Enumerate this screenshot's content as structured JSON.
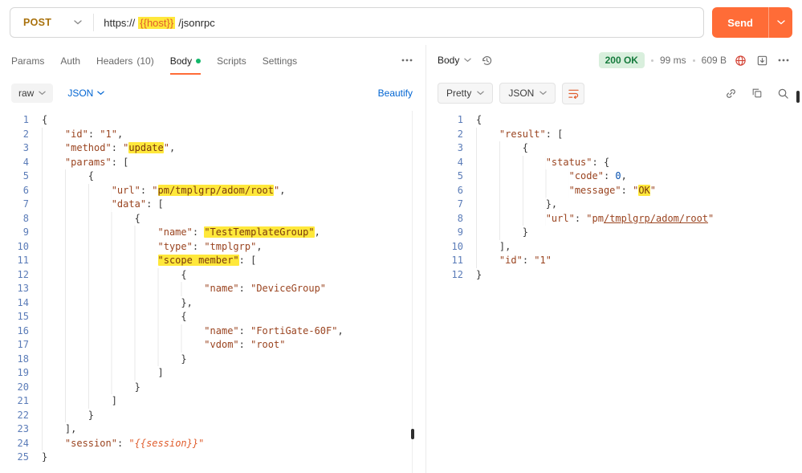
{
  "request_bar": {
    "method": "POST",
    "url_prefix": "https://",
    "url_variable": "{{host}}",
    "url_suffix": "/jsonrpc",
    "send_label": "Send"
  },
  "request_tabs": [
    {
      "label": "Params"
    },
    {
      "label": "Auth"
    },
    {
      "label": "Headers",
      "count": "(10)"
    },
    {
      "label": "Body",
      "active": true
    },
    {
      "label": "Scripts"
    },
    {
      "label": "Settings"
    }
  ],
  "request_toolbar": {
    "body_type": "raw",
    "language": "JSON",
    "beautify": "Beautify"
  },
  "response_header": {
    "body_label": "Body",
    "status": "200 OK",
    "time": "99 ms",
    "size": "609 B"
  },
  "response_toolbar": {
    "format": "Pretty",
    "language": "JSON"
  },
  "icons": {
    "method-chevron": "chevron-down",
    "send-options": "chevron-down",
    "more-options": "ellipsis-horizontal",
    "history": "clock-counterclockwise",
    "network-warning": "red-globe",
    "save-response": "download-box",
    "wrap-text": "text-wrap",
    "link": "chain-link",
    "copy": "copy-squares",
    "search": "magnifier"
  },
  "colors": {
    "accent": "#ff6c37",
    "link_blue": "#0265d2",
    "status_green": "#157a3c",
    "highlight_yellow": "#ffe83b",
    "method_post": "#a9710c"
  },
  "request_editor": {
    "lines": [
      [
        [
          "{",
          "p"
        ]
      ],
      [
        [
          "    ",
          "p"
        ],
        [
          "\"id\"",
          "s"
        ],
        [
          ": ",
          "p"
        ],
        [
          "\"1\"",
          "s"
        ],
        [
          ",",
          "p"
        ]
      ],
      [
        [
          "    ",
          "p"
        ],
        [
          "\"method\"",
          "s"
        ],
        [
          ": ",
          "p"
        ],
        [
          "\"",
          "s"
        ],
        [
          "update",
          "h"
        ],
        [
          "\"",
          "s"
        ],
        [
          ",",
          "p"
        ]
      ],
      [
        [
          "    ",
          "p"
        ],
        [
          "\"params\"",
          "s"
        ],
        [
          ": [",
          "p"
        ]
      ],
      [
        [
          "        {",
          "p"
        ]
      ],
      [
        [
          "            ",
          "p"
        ],
        [
          "\"url\"",
          "s"
        ],
        [
          ": ",
          "p"
        ],
        [
          "\"",
          "s"
        ],
        [
          "pm/tmplgrp/adom/root",
          "h"
        ],
        [
          "\"",
          "s"
        ],
        [
          ",",
          "p"
        ]
      ],
      [
        [
          "            ",
          "p"
        ],
        [
          "\"data\"",
          "s"
        ],
        [
          ": [",
          "p"
        ]
      ],
      [
        [
          "                {",
          "p"
        ]
      ],
      [
        [
          "                    ",
          "p"
        ],
        [
          "\"name\"",
          "s"
        ],
        [
          ": ",
          "p"
        ],
        [
          "\"TestTemplateGroup\"",
          "h"
        ],
        [
          ",",
          "p"
        ]
      ],
      [
        [
          "                    ",
          "p"
        ],
        [
          "\"type\"",
          "s"
        ],
        [
          ": ",
          "p"
        ],
        [
          "\"tmplgrp\"",
          "s"
        ],
        [
          ",",
          "p"
        ]
      ],
      [
        [
          "                    ",
          "p"
        ],
        [
          "\"scope member\"",
          "h"
        ],
        [
          ": [",
          "p"
        ]
      ],
      [
        [
          "                        {",
          "p"
        ]
      ],
      [
        [
          "                            ",
          "p"
        ],
        [
          "\"name\"",
          "s"
        ],
        [
          ": ",
          "p"
        ],
        [
          "\"DeviceGroup\"",
          "s"
        ]
      ],
      [
        [
          "                        },",
          "p"
        ]
      ],
      [
        [
          "                        {",
          "p"
        ]
      ],
      [
        [
          "                            ",
          "p"
        ],
        [
          "\"name\"",
          "s"
        ],
        [
          ": ",
          "p"
        ],
        [
          "\"FortiGate-60F\"",
          "s"
        ],
        [
          ",",
          "p"
        ]
      ],
      [
        [
          "                            ",
          "p"
        ],
        [
          "\"vdom\"",
          "s"
        ],
        [
          ": ",
          "p"
        ],
        [
          "\"root\"",
          "s"
        ]
      ],
      [
        [
          "                        }",
          "p"
        ]
      ],
      [
        [
          "                    ]",
          "p"
        ]
      ],
      [
        [
          "                }",
          "p"
        ]
      ],
      [
        [
          "            ]",
          "p"
        ]
      ],
      [
        [
          "        }",
          "p"
        ]
      ],
      [
        [
          "    ],",
          "p"
        ]
      ],
      [
        [
          "    ",
          "p"
        ],
        [
          "\"session\"",
          "s"
        ],
        [
          ": ",
          "p"
        ],
        [
          "\"{{session}}\"",
          "v"
        ]
      ],
      [
        [
          "}",
          "p"
        ]
      ]
    ]
  },
  "response_editor": {
    "lines": [
      [
        [
          "{",
          "p"
        ]
      ],
      [
        [
          "    ",
          "p"
        ],
        [
          "\"result\"",
          "s"
        ],
        [
          ": [",
          "p"
        ]
      ],
      [
        [
          "        {",
          "p"
        ]
      ],
      [
        [
          "            ",
          "p"
        ],
        [
          "\"status\"",
          "s"
        ],
        [
          ": {",
          "p"
        ]
      ],
      [
        [
          "                ",
          "p"
        ],
        [
          "\"code\"",
          "s"
        ],
        [
          ": ",
          "p"
        ],
        [
          "0",
          "n"
        ],
        [
          ",",
          "p"
        ]
      ],
      [
        [
          "                ",
          "p"
        ],
        [
          "\"message\"",
          "s"
        ],
        [
          ": ",
          "p"
        ],
        [
          "\"",
          "s"
        ],
        [
          "OK",
          "h"
        ],
        [
          "\"",
          "s"
        ]
      ],
      [
        [
          "            },",
          "p"
        ]
      ],
      [
        [
          "            ",
          "p"
        ],
        [
          "\"url\"",
          "s"
        ],
        [
          ": ",
          "p"
        ],
        [
          "\"pm",
          "s"
        ],
        [
          "/tmplgrp/adom/root",
          "l"
        ],
        [
          "\"",
          "s"
        ]
      ],
      [
        [
          "        }",
          "p"
        ]
      ],
      [
        [
          "    ],",
          "p"
        ]
      ],
      [
        [
          "    ",
          "p"
        ],
        [
          "\"id\"",
          "s"
        ],
        [
          ": ",
          "p"
        ],
        [
          "\"1\"",
          "s"
        ]
      ],
      [
        [
          "}",
          "p"
        ]
      ]
    ]
  }
}
